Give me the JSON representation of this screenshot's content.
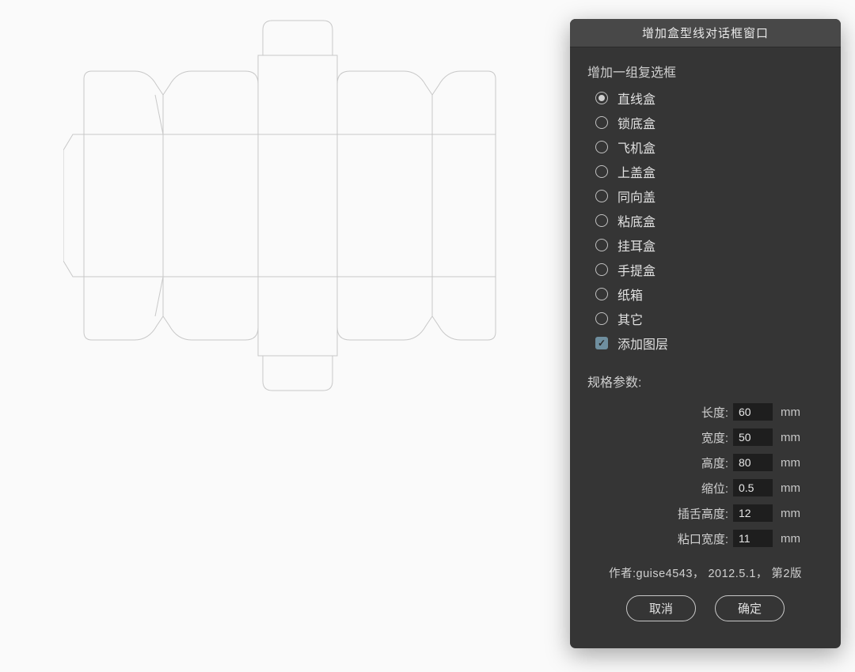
{
  "dialog": {
    "title": "增加盒型线对话框窗口",
    "group_label": "增加一组复选框",
    "options": [
      {
        "label": "直线盒",
        "selected": true
      },
      {
        "label": "锁底盒",
        "selected": false
      },
      {
        "label": "飞机盒",
        "selected": false
      },
      {
        "label": "上盖盒",
        "selected": false
      },
      {
        "label": "同向盖",
        "selected": false
      },
      {
        "label": "粘底盒",
        "selected": false
      },
      {
        "label": "挂耳盒",
        "selected": false
      },
      {
        "label": "手提盒",
        "selected": false
      },
      {
        "label": "纸箱",
        "selected": false
      },
      {
        "label": "其它",
        "selected": false
      }
    ],
    "add_layer": {
      "label": "添加图层",
      "checked": true
    },
    "params_title": "规格参数:",
    "params": [
      {
        "label": "长度:",
        "value": "60",
        "unit": "mm"
      },
      {
        "label": "宽度:",
        "value": "50",
        "unit": "mm"
      },
      {
        "label": "高度:",
        "value": "80",
        "unit": "mm"
      },
      {
        "label": "缩位:",
        "value": "0.5",
        "unit": "mm"
      },
      {
        "label": "插舌高度:",
        "value": "12",
        "unit": "mm"
      },
      {
        "label": "粘口宽度:",
        "value": "11",
        "unit": "mm"
      }
    ],
    "author_line": "作者:guise4543， 2012.5.1， 第2版",
    "cancel": "取消",
    "confirm": "确定"
  }
}
